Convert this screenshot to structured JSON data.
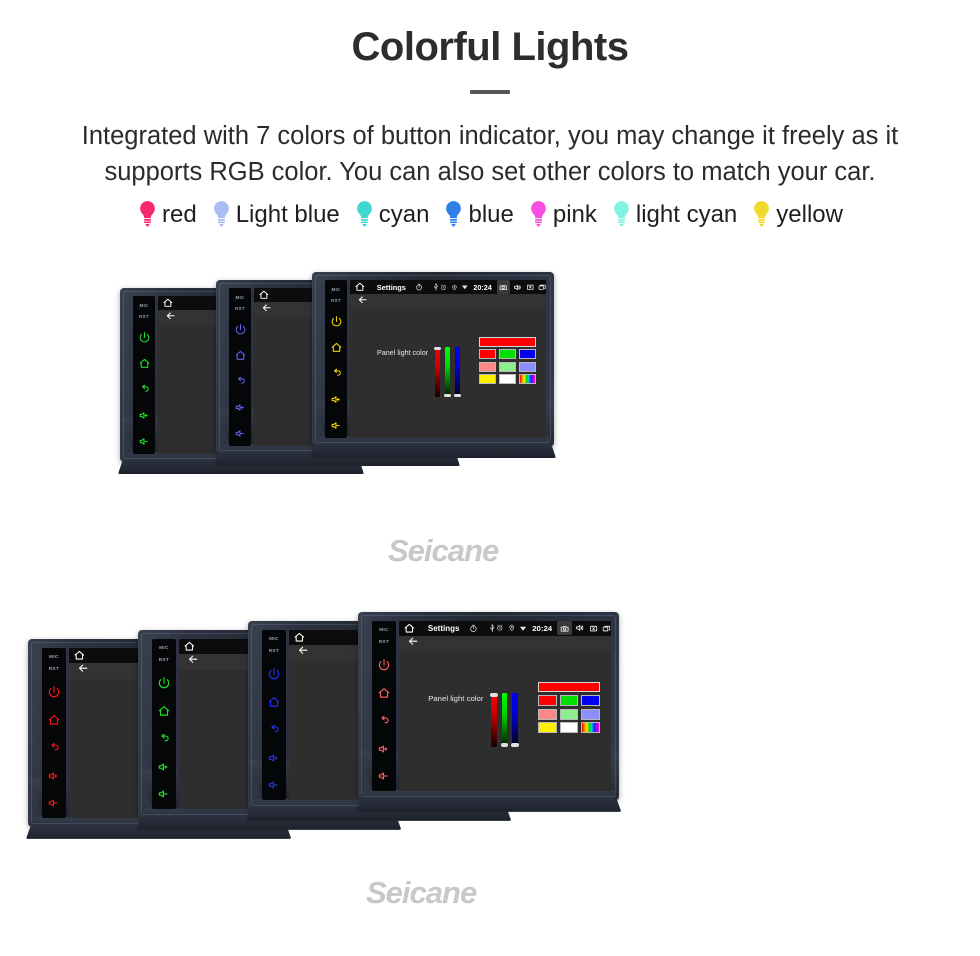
{
  "header": {
    "title": "Colorful Lights",
    "subtitle": "Integrated with 7 colors of button indicator, you may change it freely as it supports RGB color. You can also set other colors to match your car."
  },
  "bulb_legend": [
    {
      "label": "red",
      "color": "#F5296B"
    },
    {
      "label": "Light blue",
      "color": "#A8BDF0"
    },
    {
      "label": "cyan",
      "color": "#3FD8CE"
    },
    {
      "label": "blue",
      "color": "#3080E8"
    },
    {
      "label": "pink",
      "color": "#F84FE2"
    },
    {
      "label": "light cyan",
      "color": "#82F3E0"
    },
    {
      "label": "yellow",
      "color": "#F2D92E"
    }
  ],
  "status_bar": {
    "title": "Settings",
    "time": "20:24",
    "left_icons": [
      "home-icon",
      "timer-icon",
      "usb-icon"
    ],
    "right_icons": [
      "alarm-icon",
      "location-icon",
      "wifi-icon",
      "camera-icon",
      "volume-icon",
      "close-box-icon",
      "recents-icon",
      "back-arrow-icon"
    ]
  },
  "app_bar": {
    "back_icon": "back-arrow-icon"
  },
  "panel": {
    "label": "Panel light color",
    "sliders": [
      {
        "name": "red-slider",
        "thumb_position": "top"
      },
      {
        "name": "green-slider",
        "thumb_position": "bottom"
      },
      {
        "name": "blue-slider",
        "thumb_position": "bottom"
      }
    ],
    "preview_color": "#FF0000",
    "swatches": [
      [
        "#FF0000",
        "#00E000",
        "#0000EE"
      ],
      [
        "#FB8A86",
        "#8EEE8E",
        "#8E8EFA"
      ],
      [
        "#FFF000",
        "#FFFFFF",
        "rainbow"
      ]
    ]
  },
  "side_keys": {
    "mic_label": "MIC",
    "rst_label": "RST",
    "keys": [
      "power-icon",
      "home-icon",
      "back-icon",
      "volume-up-icon",
      "volume-down-icon"
    ]
  },
  "watermark": {
    "text": "Seicane"
  },
  "clusters": {
    "top_row": {
      "units": [
        {
          "name": "unit-green",
          "key_color": "#18E024"
        },
        {
          "name": "unit-purple",
          "key_color": "#6A5CF0"
        },
        {
          "name": "unit-yellow",
          "key_color": "#F2D400"
        }
      ]
    },
    "bottom_row": {
      "units": [
        {
          "name": "unit-red",
          "key_color": "#F01414"
        },
        {
          "name": "unit-green",
          "key_color": "#18E024"
        },
        {
          "name": "unit-blue",
          "key_color": "#2030F0"
        },
        {
          "name": "unit-salmon",
          "key_color": "#F06058"
        }
      ]
    }
  }
}
